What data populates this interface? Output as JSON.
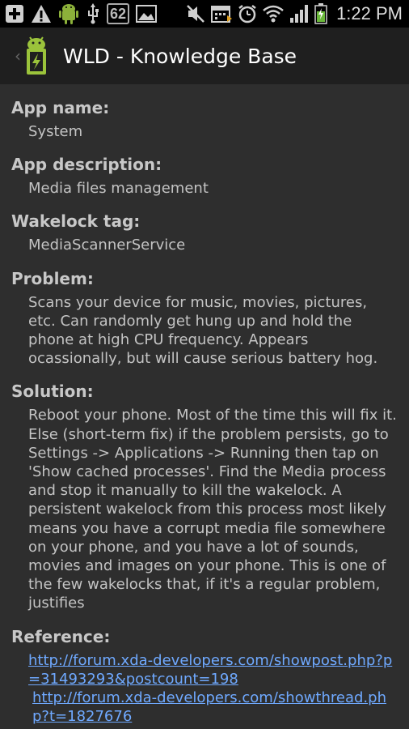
{
  "statusbar": {
    "battery_badge": "62",
    "time": "1:22 PM",
    "icons": [
      "add-icon",
      "warning-icon",
      "android-icon",
      "usb-icon",
      "gallery-icon",
      "mute-icon",
      "calendar-icon",
      "alarm-icon",
      "wifi-icon",
      "signal-icon",
      "battery-icon"
    ]
  },
  "actionbar": {
    "title": "WLD - Knowledge Base",
    "up_glyph": "‹"
  },
  "colors": {
    "background": "#2e2e2e",
    "actionbar": "#1f1f1f",
    "statusbar": "#000000",
    "link": "#6fa9ff",
    "android_green": "#9bc33b"
  },
  "fields": {
    "app_name": {
      "label": "App name:",
      "value": "System"
    },
    "app_description": {
      "label": "App description:",
      "value": "Media files management"
    },
    "wakelock_tag": {
      "label": "Wakelock tag:",
      "value": "MediaScannerService"
    },
    "problem": {
      "label": "Problem:",
      "value": "Scans your device for music, movies, pictures, etc. Can randomly get hung up and hold the phone at high CPU frequency. Appears ocassionally, but will cause serious battery hog."
    },
    "solution": {
      "label": "Solution:",
      "value": "Reboot your phone. Most of the time this will fix it. Else (short-term fix) if the problem persists, go to Settings -> Applications -> Running then tap on 'Show cached processes'. Find the Media process and stop it manually to kill the wakelock. A persistent wakelock from this process most likely means you have a corrupt media file somewhere on your phone, and you have a lot of sounds, movies and images on your phone. This is one of the few wakelocks that, if it's a regular problem, justifies"
    },
    "reference": {
      "label": "Reference:",
      "links": [
        "http://forum.xda-developers.com/showpost.php?p=31493293&postcount=198",
        "http://forum.xda-developers.com/showthread.php?t=1827676"
      ]
    }
  }
}
